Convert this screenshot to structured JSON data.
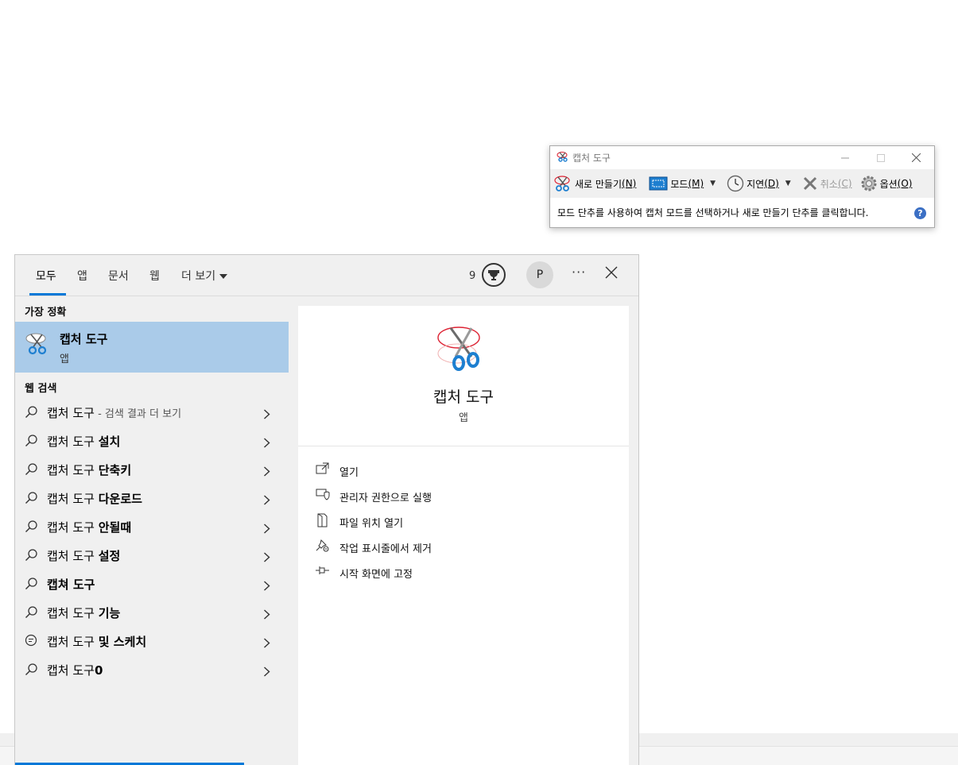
{
  "snip": {
    "title": "캡처 도구",
    "new_label": "새로 만들기",
    "new_key": "(N)",
    "mode_label": "모드",
    "mode_key": "(M)",
    "delay_label": "지연",
    "delay_key": "(D)",
    "cancel_label": "취소",
    "cancel_key": "(C)",
    "options_label": "옵션",
    "options_key": "(O)",
    "status": "모드 단추를 사용하여 캡처 모드를 선택하거나 새로 만들기 단추를 클릭합니다.",
    "help": "?"
  },
  "search": {
    "tabs": [
      {
        "label": "모두"
      },
      {
        "label": "앱"
      },
      {
        "label": "문서"
      },
      {
        "label": "웹"
      },
      {
        "label": "더 보기"
      }
    ],
    "reward_count": "9",
    "avatar": "P",
    "more": "···",
    "best_match_label": "가장 정확",
    "best": {
      "title": "캡처 도구",
      "sub": "앱"
    },
    "web_label": "웹 검색",
    "web_results": [
      {
        "prefix": "캡처 도구",
        "bold": "",
        "hint": " - 검색 결과 더 보기"
      },
      {
        "prefix": "캡처 도구 ",
        "bold": "설치",
        "hint": ""
      },
      {
        "prefix": "캡처 도구 ",
        "bold": "단축키",
        "hint": ""
      },
      {
        "prefix": "캡처 도구 ",
        "bold": "다운로드",
        "hint": ""
      },
      {
        "prefix": "캡처 도구 ",
        "bold": "안될때",
        "hint": ""
      },
      {
        "prefix": "캡처 도구 ",
        "bold": "설정",
        "hint": ""
      },
      {
        "prefix": "",
        "bold": "캡쳐 도구",
        "hint": ""
      },
      {
        "prefix": "캡처 도구 ",
        "bold": "기능",
        "hint": ""
      },
      {
        "prefix": "캡처 도구 ",
        "bold": "및 스케치",
        "hint": ""
      },
      {
        "prefix": "캡처 도구",
        "bold": "0",
        "hint": ""
      }
    ],
    "detail": {
      "title": "캡처 도구",
      "sub": "앱",
      "actions": [
        {
          "label": "열기",
          "icon": "open-icon"
        },
        {
          "label": "관리자 권한으로 실행",
          "icon": "admin-shield-icon"
        },
        {
          "label": "파일 위치 열기",
          "icon": "file-location-icon"
        },
        {
          "label": "작업 표시줄에서 제거",
          "icon": "unpin-icon"
        },
        {
          "label": "시작 화면에 고정",
          "icon": "pin-icon"
        }
      ]
    },
    "accent": "#0078d7",
    "highlight": "#aacbe9"
  }
}
